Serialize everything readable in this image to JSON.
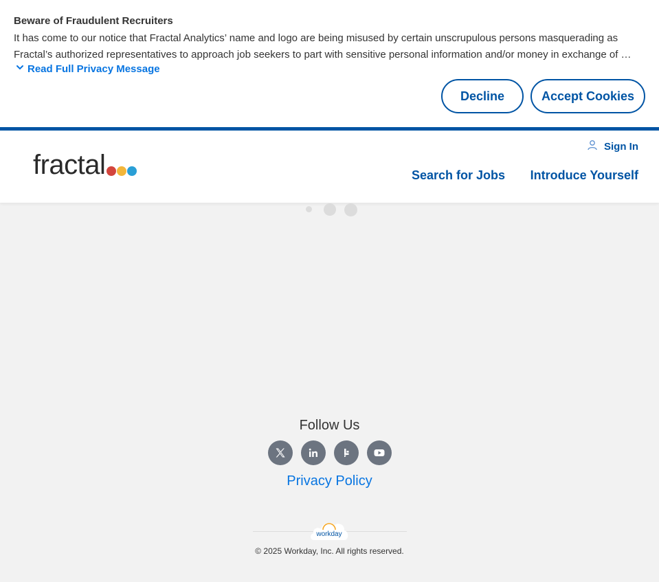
{
  "banner": {
    "title": "Beware of Fraudulent Recruiters",
    "text": "It has come to our notice that Fractal Analytics’ name and logo are being misused by certain unscrupulous persons masquerading as Fractal’s authorized representatives to approach job seekers to part with sensitive personal information and/or money in exchange of …",
    "read_more": "Read Full Privacy Message",
    "decline": "Decline",
    "accept": "Accept Cookies"
  },
  "header": {
    "logo_text": "fractal",
    "logo_dot_colors": [
      "#d3453d",
      "#f3b63a",
      "#2a9fd6"
    ],
    "sign_in": "Sign In",
    "nav": [
      "Search for Jobs",
      "Introduce Yourself"
    ]
  },
  "footer": {
    "follow_us": "Follow Us",
    "socials": [
      "x-icon",
      "linkedin-icon",
      "glassdoor-icon",
      "youtube-icon"
    ],
    "privacy_policy": "Privacy Policy",
    "workday_logo": "workday",
    "copyright": "© 2025 Workday, Inc. All rights reserved."
  },
  "colors": {
    "brand_blue": "#0054a4",
    "link_blue": "#0875e1",
    "social_gray": "#6c7480"
  }
}
